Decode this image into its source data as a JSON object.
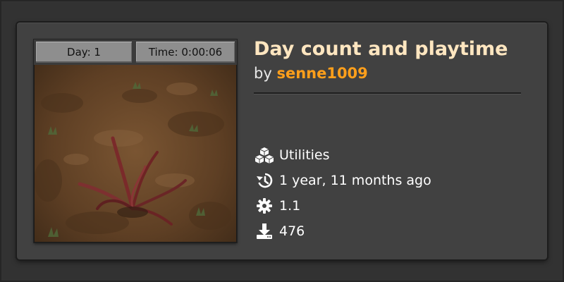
{
  "mod": {
    "title": "Day count and playtime",
    "by_label": "by",
    "author": "senne1009"
  },
  "thumbnail": {
    "day_label": "Day: 1",
    "time_label": "Time: 0:00:06"
  },
  "meta": {
    "category": {
      "icon": "cubes-icon",
      "label": "Utilities"
    },
    "updated": {
      "icon": "history-icon",
      "label": "1 year, 11 months ago"
    },
    "version": {
      "icon": "gear-icon",
      "label": "1.1"
    },
    "downloads": {
      "icon": "download-icon",
      "label": "476"
    }
  },
  "colors": {
    "title": "#ffe6c0",
    "author": "#ff9f1b",
    "card_bg": "#414141",
    "page_bg": "#323232"
  }
}
